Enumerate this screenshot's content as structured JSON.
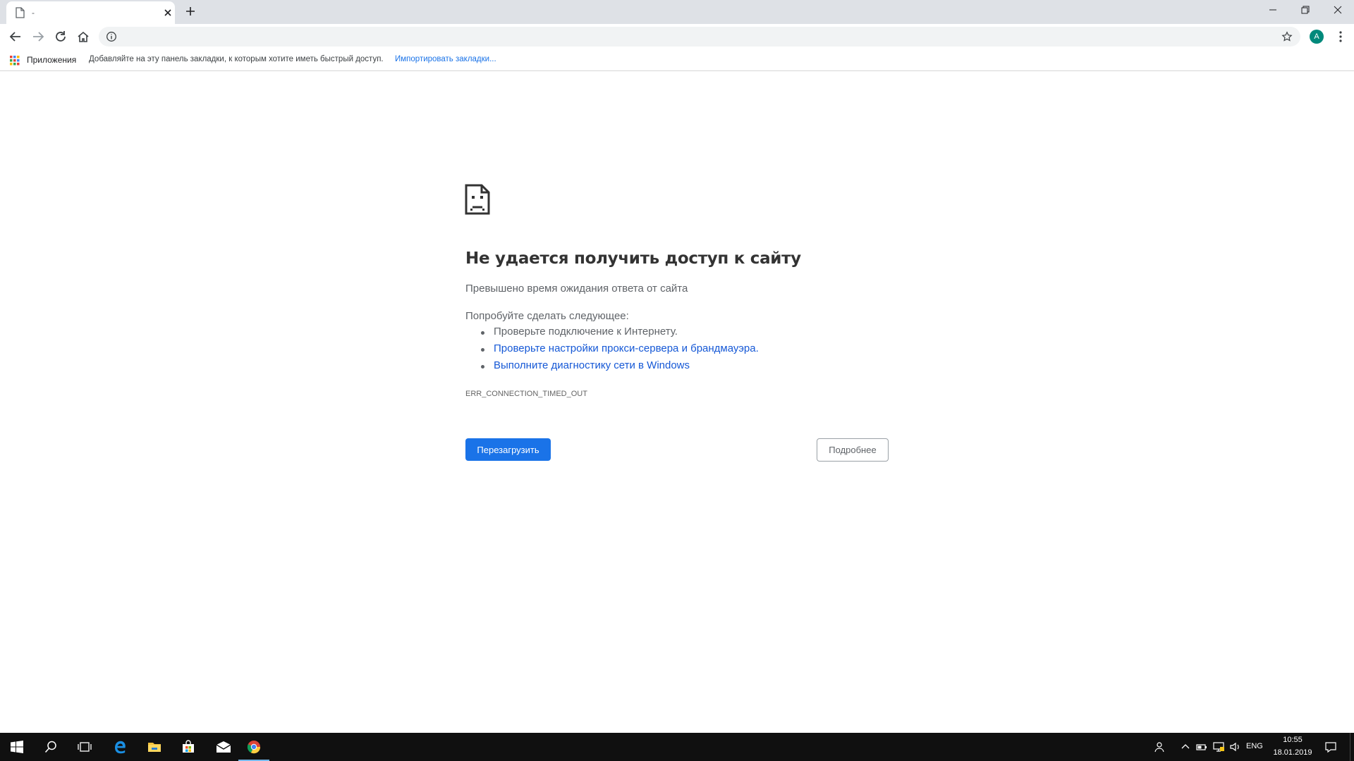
{
  "browser": {
    "tab": {
      "title": "-",
      "favicon": "page-icon",
      "close_icon": "close-icon"
    },
    "new_tab_icon": "plus-icon",
    "window_controls": [
      "minimize-icon",
      "maximize-icon",
      "close-icon"
    ],
    "toolbar": {
      "back_icon": "back-arrow-icon",
      "forward_icon": "forward-arrow-icon",
      "reload_icon": "reload-icon",
      "home_icon": "home-icon",
      "omnibox": {
        "value": "",
        "info_icon": "info-icon",
        "star_icon": "star-icon"
      },
      "avatar_letter": "A",
      "avatar_color": "#00897b",
      "menu_icon": "kebab-menu-icon"
    },
    "bookmarks_bar": {
      "apps_label": "Приложения",
      "hint": "Добавляйте на эту панель закладки, к которым хотите иметь быстрый доступ.",
      "import_link": "Импортировать закладки..."
    }
  },
  "error_page": {
    "icon": "sad-page-icon",
    "title": "Не удается получить доступ к сайту",
    "subtitle": "Превышено время ожидания ответа от сайта",
    "try_heading": "Попробуйте сделать следующее:",
    "suggestions": [
      {
        "text": "Проверьте подключение к Интернету.",
        "link": false
      },
      {
        "text": "Проверьте настройки прокси-сервера и брандмауэра.",
        "link": true
      },
      {
        "text": "Выполните диагностику сети в Windows",
        "link": true
      }
    ],
    "error_code": "ERR_CONNECTION_TIMED_OUT",
    "reload_button": "Перезагрузить",
    "details_button": "Подробнее",
    "colors": {
      "primary": "#1a73e8",
      "link": "#1558d6",
      "text": "#5f6368"
    }
  },
  "taskbar": {
    "apps": [
      "windows-start-icon",
      "search-icon",
      "task-view-icon",
      "edge-icon",
      "file-explorer-icon",
      "store-icon",
      "mail-icon",
      "chrome-icon"
    ],
    "tray": {
      "icons": [
        "people-icon",
        "chevron-up-icon",
        "battery-icon",
        "network-icon",
        "volume-icon"
      ],
      "language": "ENG",
      "time": "10:55",
      "date": "18.01.2019",
      "notification_icon": "action-center-icon"
    }
  }
}
